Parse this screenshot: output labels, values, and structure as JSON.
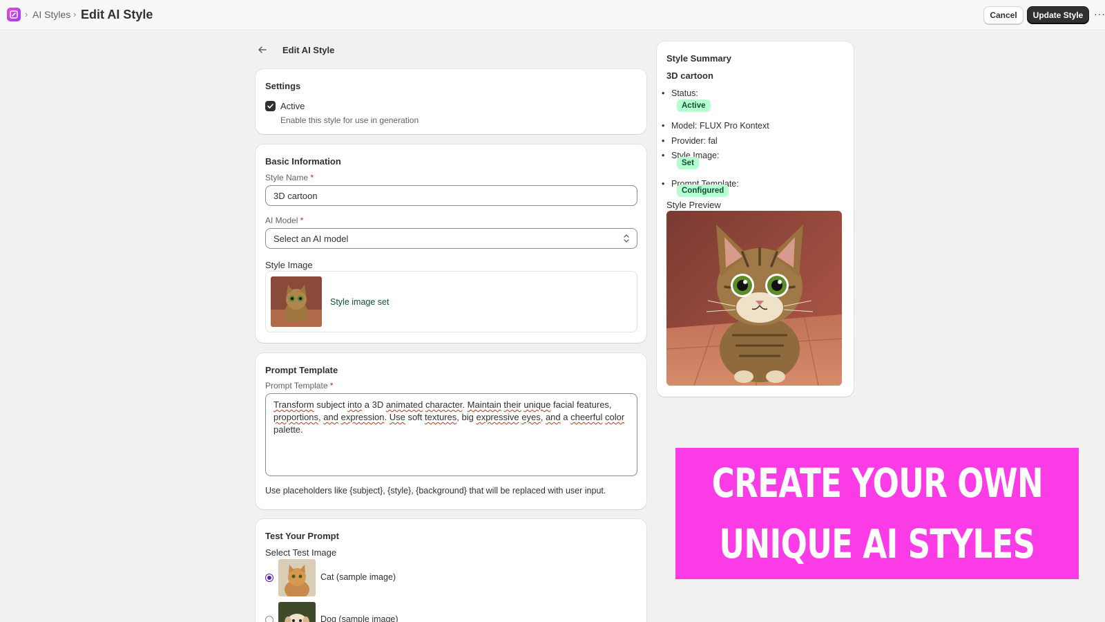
{
  "breadcrumb": {
    "parent": "AI Styles",
    "current": "Edit AI Style"
  },
  "topbar": {
    "cancel_label": "Cancel",
    "update_label": "Update Style",
    "more_label": "···"
  },
  "page": {
    "title": "Edit AI Style"
  },
  "settings": {
    "title": "Settings",
    "active_label": "Active",
    "active_checked": true,
    "active_help": "Enable this style for use in generation"
  },
  "basic": {
    "title": "Basic Information",
    "style_name_label": "Style Name",
    "style_name_value": "3D cartoon",
    "model_label": "AI Model",
    "model_value": "Select an AI model",
    "style_image_label": "Style Image",
    "style_image_status": "Style image set",
    "required_mark": "*"
  },
  "prompt": {
    "title": "Prompt Template",
    "label": "Prompt Template",
    "value_line1": [
      "Transform",
      " subject ",
      "into",
      " a 3D ",
      "animated",
      " ",
      "character",
      ". ",
      "Maintain",
      " ",
      "their",
      " ",
      "unique",
      " facial features,"
    ],
    "value_line2": [
      "proportions",
      ", ",
      "and",
      " ",
      "expression",
      ". ",
      "Use",
      " soft ",
      "textures",
      ", big ",
      "expressive",
      " ",
      "eyes",
      ", ",
      "and",
      " a ",
      "cheerful",
      " ",
      "color"
    ],
    "value_line3": "palette.",
    "help": "Use placeholders like {subject}, {style}, {background} that will be replaced with user input."
  },
  "test": {
    "title": "Test Your Prompt",
    "select_label": "Select Test Image",
    "options": [
      {
        "label": "Cat (sample image)",
        "selected": true
      },
      {
        "label": "Dog (sample image)",
        "selected": false
      }
    ]
  },
  "summary": {
    "title": "Style Summary",
    "style_name": "3D cartoon",
    "status_label": "Status:",
    "status_value": "Active",
    "model_line": "Model: FLUX Pro Kontext",
    "provider_line": "Provider: fal",
    "style_image_label": "Style Image:",
    "style_image_value": "Set",
    "prompt_template_label": "Prompt Template:",
    "prompt_template_value": "Configured",
    "preview_label": "Style Preview"
  },
  "promo": {
    "line1": "CREATE YOUR OWN",
    "line2": "UNIQUE AI STYLES"
  },
  "colors": {
    "accent": "#fb3ce6",
    "badge_bg": "#b4fed2",
    "badge_text": "#0c5132",
    "primary_button": "#303030"
  }
}
